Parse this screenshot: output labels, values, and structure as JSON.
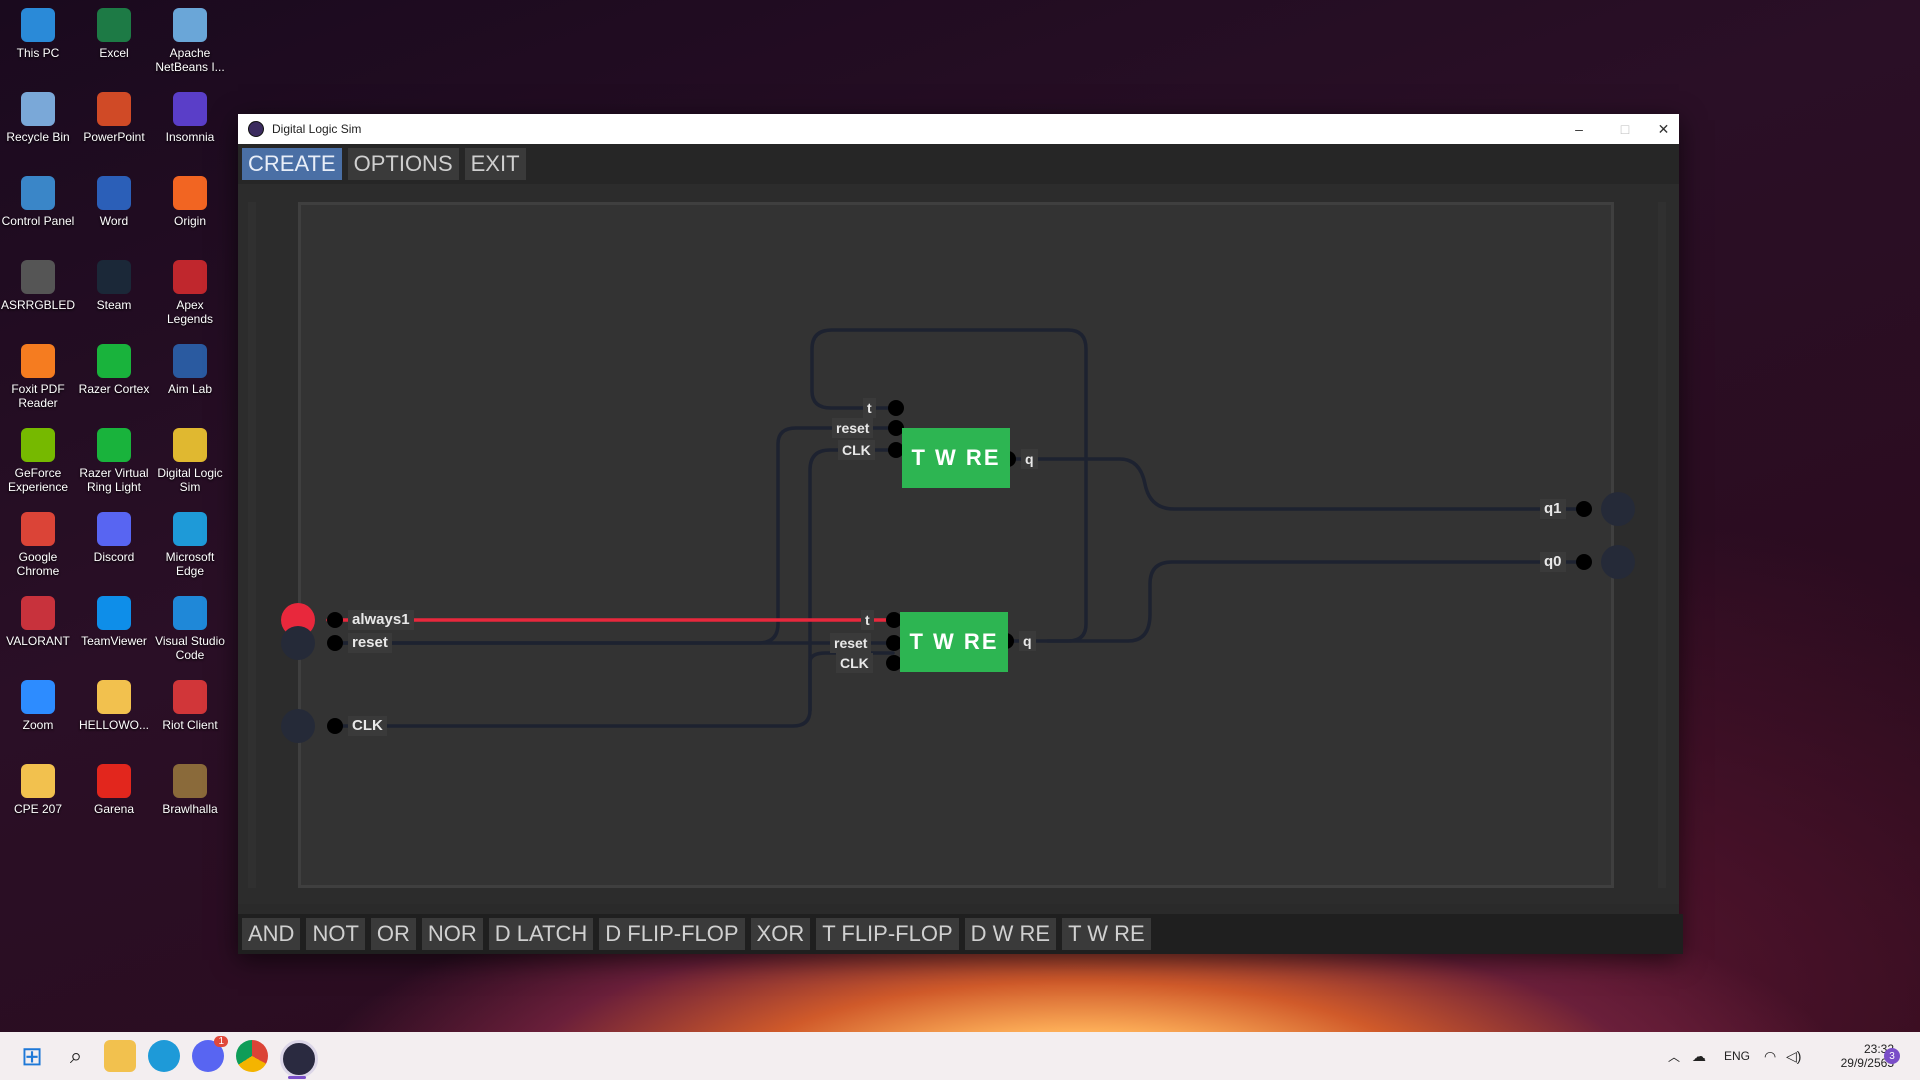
{
  "desktop": {
    "icons": [
      {
        "label": "This PC",
        "icon": "this-pc-icon",
        "color": "#2a8ad8"
      },
      {
        "label": "Excel",
        "icon": "excel-icon",
        "color": "#1d7a45"
      },
      {
        "label": "Apache NetBeans I...",
        "icon": "netbeans-icon",
        "color": "#6aa6d8"
      },
      {
        "label": "Recycle Bin",
        "icon": "recycle-bin-icon",
        "color": "#7aa8d8"
      },
      {
        "label": "PowerPoint",
        "icon": "powerpoint-icon",
        "color": "#d04a26"
      },
      {
        "label": "Insomnia",
        "icon": "insomnia-icon",
        "color": "#5a3ec8"
      },
      {
        "label": "Control Panel",
        "icon": "control-panel-icon",
        "color": "#3a86c8"
      },
      {
        "label": "Word",
        "icon": "word-icon",
        "color": "#2b5fb8"
      },
      {
        "label": "Origin",
        "icon": "origin-icon",
        "color": "#f26522"
      },
      {
        "label": "ASRRGBLED",
        "icon": "asrrgbled-icon",
        "color": "#555555"
      },
      {
        "label": "Steam",
        "icon": "steam-icon",
        "color": "#1b2838"
      },
      {
        "label": "Apex Legends",
        "icon": "apex-icon",
        "color": "#c0272d"
      },
      {
        "label": "Foxit PDF Reader",
        "icon": "foxit-icon",
        "color": "#f57c20"
      },
      {
        "label": "Razer Cortex",
        "icon": "razer-cortex-icon",
        "color": "#19b33c"
      },
      {
        "label": "Aim Lab",
        "icon": "aimlab-icon",
        "color": "#2a5aa0"
      },
      {
        "label": "GeForce Experience",
        "icon": "geforce-icon",
        "color": "#76b900"
      },
      {
        "label": "Razer Virtual Ring Light",
        "icon": "razer-ring-icon",
        "color": "#19b33c"
      },
      {
        "label": "Digital Logic Sim",
        "icon": "digital-logic-sim-icon",
        "color": "#e0b830"
      },
      {
        "label": "Google Chrome",
        "icon": "chrome-icon",
        "color": "#db4437"
      },
      {
        "label": "Discord",
        "icon": "discord-icon",
        "color": "#5865f2"
      },
      {
        "label": "Microsoft Edge",
        "icon": "edge-icon",
        "color": "#1e9ad8"
      },
      {
        "label": "VALORANT",
        "icon": "valorant-icon",
        "color": "#c8323c"
      },
      {
        "label": "TeamViewer",
        "icon": "teamviewer-icon",
        "color": "#0e8ee9"
      },
      {
        "label": "Visual Studio Code",
        "icon": "vscode-icon",
        "color": "#1f88d8"
      },
      {
        "label": "Zoom",
        "icon": "zoom-icon",
        "color": "#2d8cff"
      },
      {
        "label": "HELLOWO...",
        "icon": "folder-icon",
        "color": "#f2c14e"
      },
      {
        "label": "Riot Client",
        "icon": "riot-icon",
        "color": "#d13639"
      },
      {
        "label": "CPE 207",
        "icon": "folder-icon",
        "color": "#f2c14e"
      },
      {
        "label": "Garena",
        "icon": "garena-icon",
        "color": "#e2261d"
      },
      {
        "label": "Brawlhalla",
        "icon": "brawlhalla-icon",
        "color": "#8a6a3a"
      }
    ]
  },
  "window": {
    "title": "Digital Logic Sim",
    "minimize": "–",
    "maximize": "□",
    "close": "✕",
    "menu": {
      "create": "CREATE",
      "options": "OPTIONS",
      "exit": "EXIT"
    },
    "toolbar": [
      "AND",
      "NOT",
      "OR",
      "NOR",
      "D LATCH",
      "D FLIP-FLOP",
      "XOR",
      "T FLIP-FLOP",
      "D W RE",
      "T W RE"
    ]
  },
  "circuit": {
    "inputs": {
      "always1": "always1",
      "reset": "reset",
      "clk": "CLK"
    },
    "outputs": {
      "q1": "q1",
      "q0": "q0"
    },
    "chip_top": {
      "name": "T W RE",
      "pin_t": "t",
      "pin_reset": "reset",
      "pin_clk": "CLK",
      "pin_q": "q"
    },
    "chip_bottom": {
      "name": "T W RE",
      "pin_t": "t",
      "pin_reset": "reset",
      "pin_clk": "CLK",
      "pin_q": "q"
    },
    "colors": {
      "active": "#e8283c",
      "wire": "#1d2230",
      "chip": "#2db552",
      "pin": "#000000"
    }
  },
  "taskbar": {
    "apps": [
      "start-icon",
      "search-icon",
      "file-explorer-icon",
      "edge-icon",
      "discord-icon",
      "chrome-icon",
      "digital-logic-sim-icon"
    ],
    "discord_badge": "1",
    "lang": "ENG",
    "time": "23:32",
    "date": "29/9/2565",
    "notification_count": "3"
  }
}
